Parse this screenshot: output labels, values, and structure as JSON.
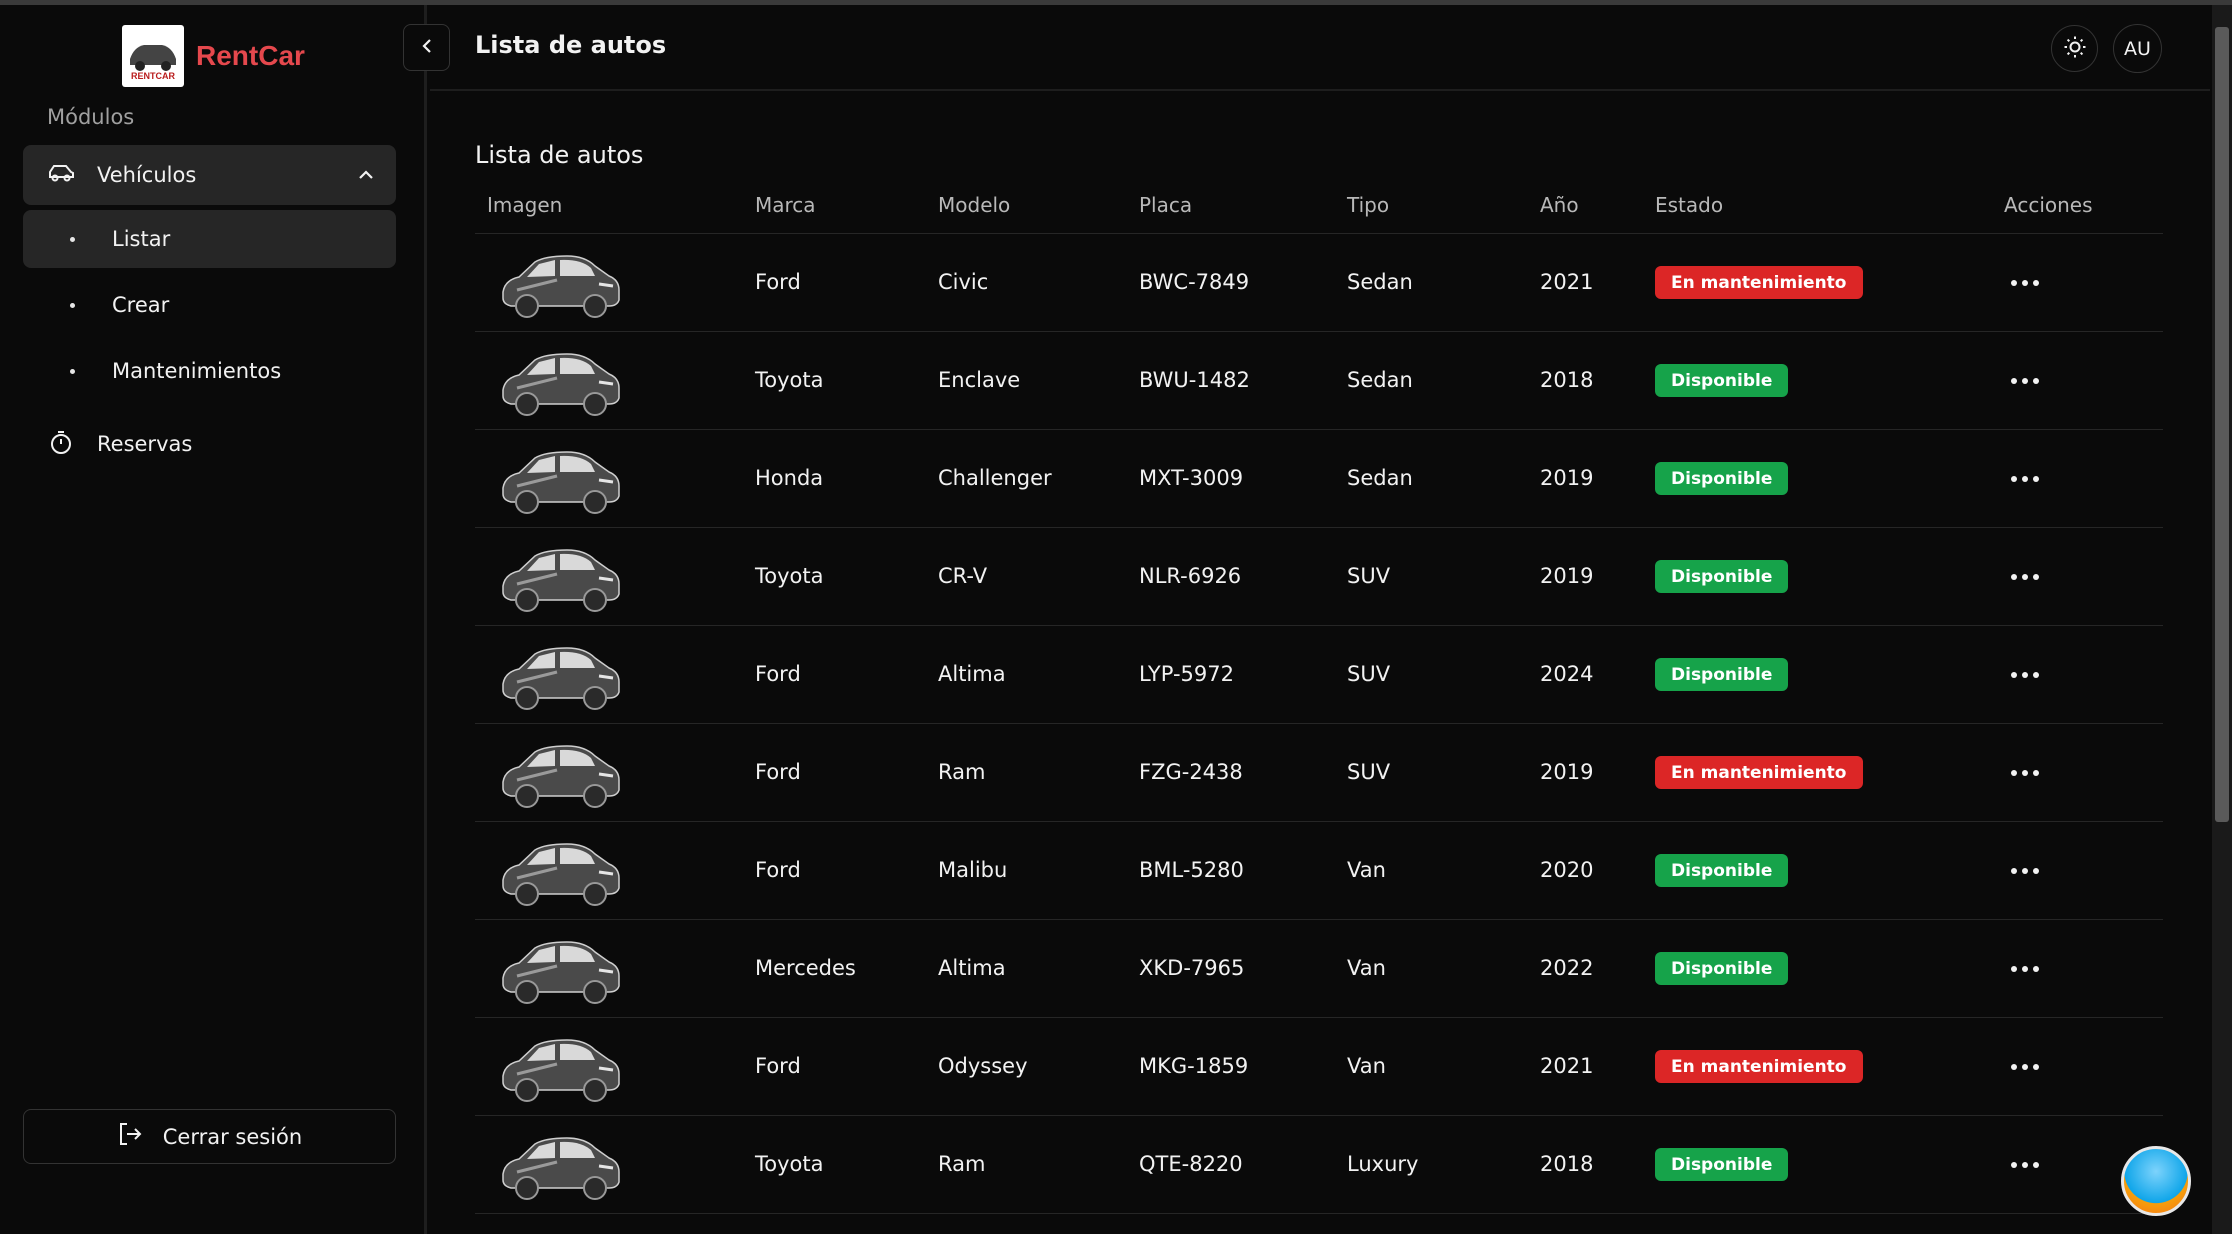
{
  "app": {
    "name": "RentCar",
    "logo_text": "RENTCAR"
  },
  "sidebar": {
    "section_label": "Módulos",
    "group": {
      "label": "Vehículos",
      "icon": "car-icon",
      "expanded": true
    },
    "sub_items": [
      {
        "label": "Listar",
        "active": true
      },
      {
        "label": "Crear",
        "active": false
      },
      {
        "label": "Mantenimientos",
        "active": false
      }
    ],
    "reservas": {
      "label": "Reservas",
      "icon": "timer-icon"
    },
    "logout": {
      "label": "Cerrar sesión",
      "icon": "logout-icon"
    }
  },
  "header": {
    "title": "Lista de autos",
    "avatar": "AU",
    "theme_icon": "sun-icon"
  },
  "table": {
    "title": "Lista de autos",
    "columns": [
      "Imagen",
      "Marca",
      "Modelo",
      "Placa",
      "Tipo",
      "Año",
      "Estado",
      "Acciones"
    ],
    "rows": [
      {
        "marca": "Ford",
        "modelo": "Civic",
        "placa": "BWC-7849",
        "tipo": "Sedan",
        "anio": "2021",
        "estado": "En mantenimiento",
        "status": "red"
      },
      {
        "marca": "Toyota",
        "modelo": "Enclave",
        "placa": "BWU-1482",
        "tipo": "Sedan",
        "anio": "2018",
        "estado": "Disponible",
        "status": "green"
      },
      {
        "marca": "Honda",
        "modelo": "Challenger",
        "placa": "MXT-3009",
        "tipo": "Sedan",
        "anio": "2019",
        "estado": "Disponible",
        "status": "green"
      },
      {
        "marca": "Toyota",
        "modelo": "CR-V",
        "placa": "NLR-6926",
        "tipo": "SUV",
        "anio": "2019",
        "estado": "Disponible",
        "status": "green"
      },
      {
        "marca": "Ford",
        "modelo": "Altima",
        "placa": "LYP-5972",
        "tipo": "SUV",
        "anio": "2024",
        "estado": "Disponible",
        "status": "green"
      },
      {
        "marca": "Ford",
        "modelo": "Ram",
        "placa": "FZG-2438",
        "tipo": "SUV",
        "anio": "2019",
        "estado": "En mantenimiento",
        "status": "red"
      },
      {
        "marca": "Ford",
        "modelo": "Malibu",
        "placa": "BML-5280",
        "tipo": "Van",
        "anio": "2020",
        "estado": "Disponible",
        "status": "green"
      },
      {
        "marca": "Mercedes",
        "modelo": "Altima",
        "placa": "XKD-7965",
        "tipo": "Van",
        "anio": "2022",
        "estado": "Disponible",
        "status": "green"
      },
      {
        "marca": "Ford",
        "modelo": "Odyssey",
        "placa": "MKG-1859",
        "tipo": "Van",
        "anio": "2021",
        "estado": "En mantenimiento",
        "status": "red"
      },
      {
        "marca": "Toyota",
        "modelo": "Ram",
        "placa": "QTE-8220",
        "tipo": "Luxury",
        "anio": "2018",
        "estado": "Disponible",
        "status": "green"
      }
    ]
  },
  "colors": {
    "brand": "#e5484d",
    "maintenance": "#dc2626",
    "available": "#16a34a",
    "background": "#0a0a0a"
  }
}
